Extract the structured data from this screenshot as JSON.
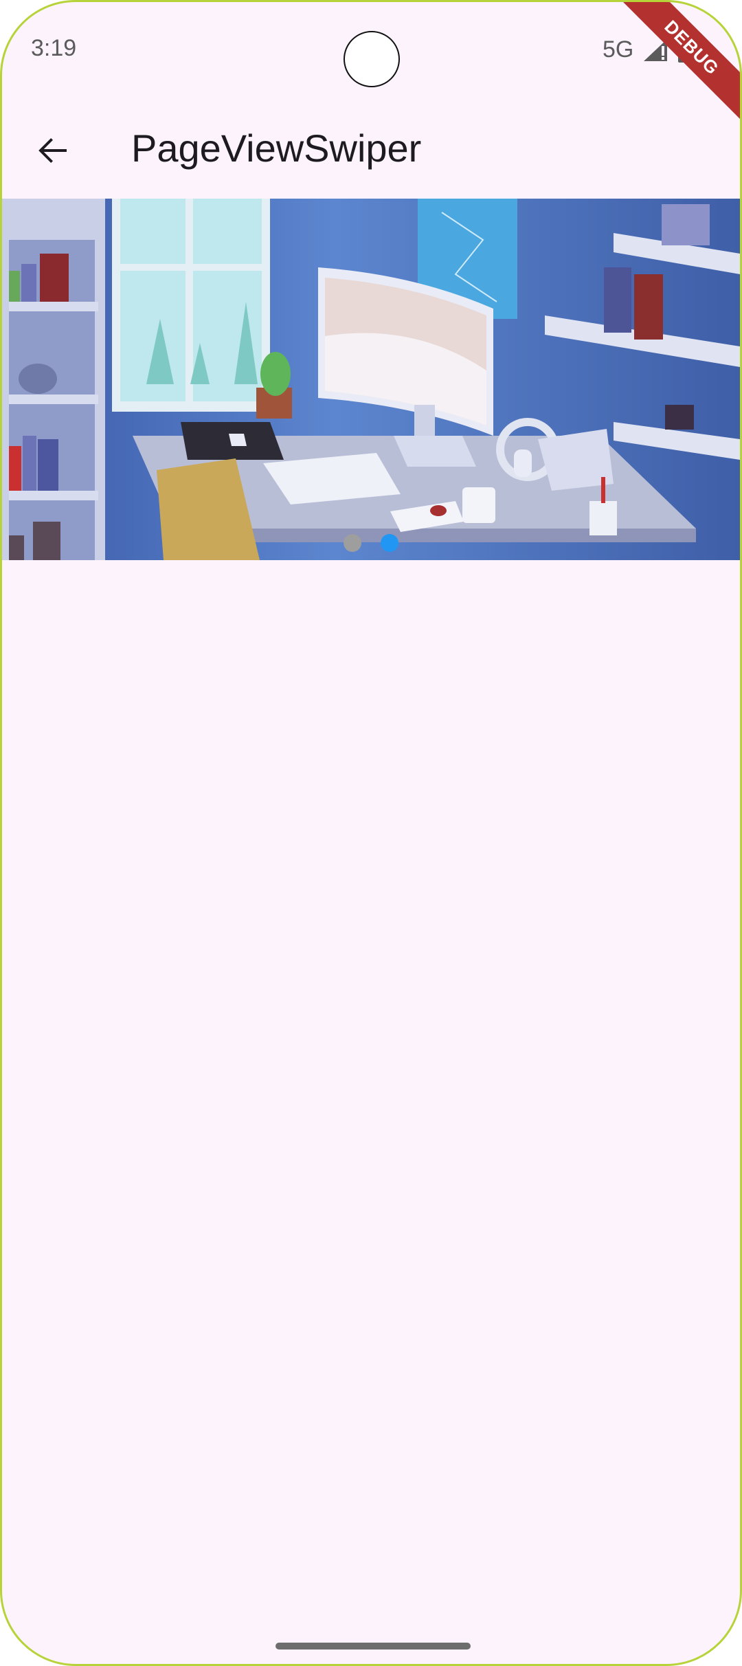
{
  "status_bar": {
    "time": "3:19",
    "network": "5G"
  },
  "debug_banner": "DEBUG",
  "app_bar": {
    "title": "PageViewSwiper"
  },
  "carousel": {
    "page_count": 2,
    "active_page": 2,
    "dot_colors": {
      "inactive": "#9e9e9e",
      "active": "#2196f3"
    }
  },
  "colors": {
    "background": "#fcf3fc",
    "appbar_text": "#1d1b20"
  },
  "icons": {
    "back": "arrow-back-icon"
  }
}
